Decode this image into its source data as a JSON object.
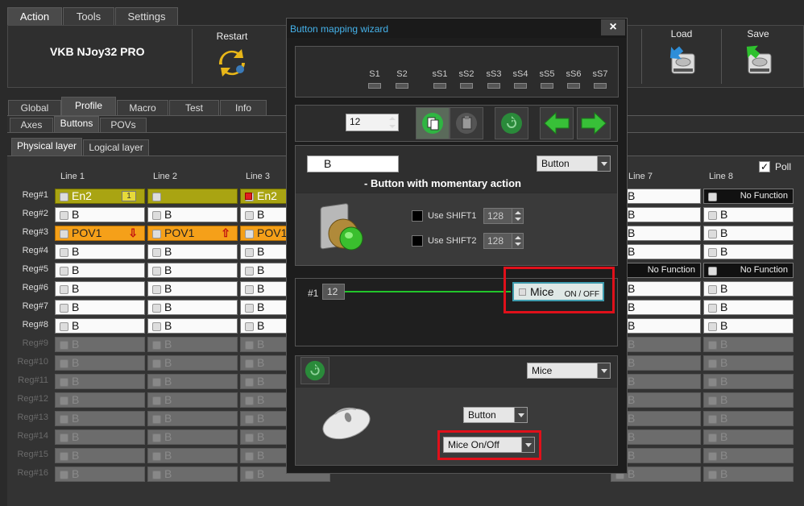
{
  "menu": {
    "tabs": [
      "Action",
      "Tools",
      "Settings"
    ]
  },
  "device": {
    "name": "VKB NJoy32 PRO",
    "restart": "Restart",
    "load": "Load",
    "save": "Save"
  },
  "mainTabs": [
    "Global",
    "Profile",
    "Macro",
    "Test",
    "Info"
  ],
  "subTabs": [
    "Axes",
    "Buttons",
    "POVs"
  ],
  "layerTabs": [
    "Physical layer",
    "Logical layer"
  ],
  "poll": "Poll",
  "columns": [
    "Line 1",
    "Line 2",
    "Line 3",
    "Line 7",
    "Line 8"
  ],
  "rows": [
    "Reg#1",
    "Reg#2",
    "Reg#3",
    "Reg#4",
    "Reg#5",
    "Reg#6",
    "Reg#7",
    "Reg#8",
    "Reg#9",
    "Reg#10",
    "Reg#11",
    "Reg#12",
    "Reg#13",
    "Reg#14",
    "Reg#15",
    "Reg#16"
  ],
  "cells": {
    "B": "B",
    "en2": "En2",
    "pov1": "POV1",
    "badge": "1",
    "noFunction": "No Function"
  },
  "wizard": {
    "title": "Button mapping wizard",
    "close": "×",
    "shifts": [
      "S1",
      "S2",
      "sS1",
      "sS2",
      "sS3",
      "sS4",
      "sS5",
      "sS6",
      "sS7"
    ],
    "buttonNumber": "12",
    "buttonName": "B",
    "typeSelect": "Button",
    "description": "- Button with momentary action",
    "shift1Label": "Use SHIFT1",
    "shift1Value": "128",
    "shift2Label": "Use SHIFT2",
    "shift2Value": "128",
    "mapIndex": "#1",
    "mapNumber": "12",
    "mapTarget": "Mice",
    "mapTargetSub": "ON / OFF",
    "categorySelect": "Mice",
    "subTypeSelect": "Button",
    "functionSelect": "Mice On/Off"
  }
}
